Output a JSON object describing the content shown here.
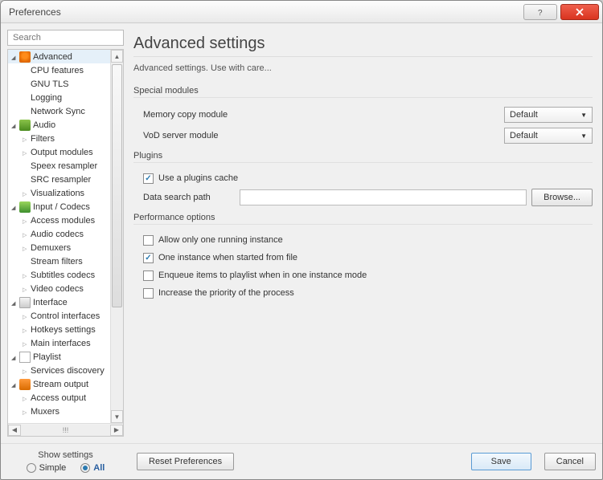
{
  "window": {
    "title": "Preferences"
  },
  "search": {
    "placeholder": "Search"
  },
  "tree": {
    "advanced": {
      "label": "Advanced",
      "children": {
        "cpu": "CPU features",
        "gnutls": "GNU TLS",
        "logging": "Logging",
        "netsync": "Network Sync"
      }
    },
    "audio": {
      "label": "Audio",
      "children": {
        "filters": "Filters",
        "output": "Output modules",
        "speex": "Speex resampler",
        "src": "SRC resampler",
        "viz": "Visualizations"
      }
    },
    "input": {
      "label": "Input / Codecs",
      "children": {
        "access": "Access modules",
        "acodecs": "Audio codecs",
        "demux": "Demuxers",
        "sfilters": "Stream filters",
        "scodecs": "Subtitles codecs",
        "vcodecs": "Video codecs"
      }
    },
    "interface": {
      "label": "Interface",
      "children": {
        "control": "Control interfaces",
        "hotkeys": "Hotkeys settings",
        "main": "Main interfaces"
      }
    },
    "playlist": {
      "label": "Playlist",
      "children": {
        "services": "Services discovery"
      }
    },
    "stream": {
      "label": "Stream output",
      "children": {
        "aout": "Access output",
        "mux": "Muxers"
      }
    }
  },
  "scroll_marker": "!!!",
  "main": {
    "title": "Advanced settings",
    "subtitle": "Advanced settings. Use with care...",
    "groups": {
      "special": {
        "title": "Special modules",
        "memcopy": {
          "label": "Memory copy module",
          "value": "Default"
        },
        "vod": {
          "label": "VoD server module",
          "value": "Default"
        }
      },
      "plugins": {
        "title": "Plugins",
        "cache": {
          "label": "Use a plugins cache",
          "checked": true
        },
        "path": {
          "label": "Data search path",
          "value": "",
          "browse": "Browse..."
        }
      },
      "perf": {
        "title": "Performance options",
        "one": {
          "label": "Allow only one running instance",
          "checked": false
        },
        "file": {
          "label": "One instance when started from file",
          "checked": true
        },
        "enqueue": {
          "label": "Enqueue items to playlist when in one instance mode",
          "checked": false
        },
        "priority": {
          "label": "Increase the priority of the process",
          "checked": false
        }
      }
    }
  },
  "footer": {
    "show_settings": "Show settings",
    "simple": "Simple",
    "all": "All",
    "reset": "Reset Preferences",
    "save": "Save",
    "cancel": "Cancel"
  }
}
